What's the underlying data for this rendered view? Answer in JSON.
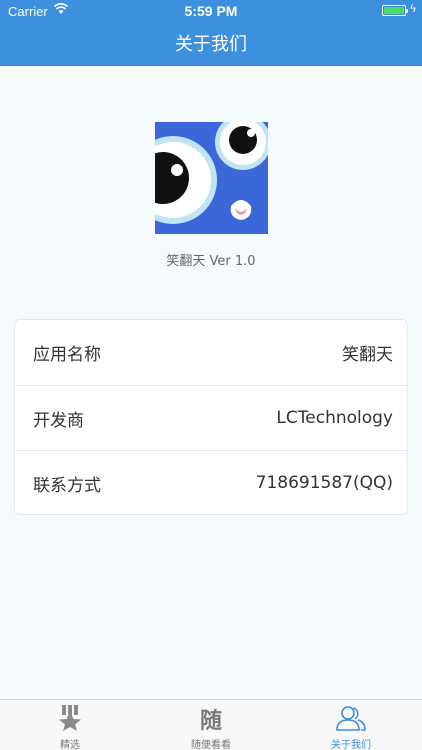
{
  "status_bar": {
    "carrier": "Carrier",
    "time": "5:59 PM"
  },
  "nav": {
    "title": "关于我们"
  },
  "app": {
    "version_text": "笑翻天 Ver 1.0",
    "icon": "app-logo-cartoon-face"
  },
  "info_rows": [
    {
      "label": "应用名称",
      "value": "笑翻天"
    },
    {
      "label": "开发商",
      "value": "LCTechnology"
    },
    {
      "label": "联系方式",
      "value": "718691587(QQ)"
    }
  ],
  "tabs": [
    {
      "label": "精选",
      "icon": "star-medal-icon",
      "active": false
    },
    {
      "label": "随便看看",
      "icon": "sui-character-icon",
      "glyph": "随",
      "active": false
    },
    {
      "label": "关于我们",
      "icon": "people-icon",
      "active": true
    }
  ],
  "colors": {
    "nav_background": "#3d90de",
    "page_background": "#f5fbfc",
    "active_tab": "#3d90de",
    "inactive_tab": "#777777"
  }
}
